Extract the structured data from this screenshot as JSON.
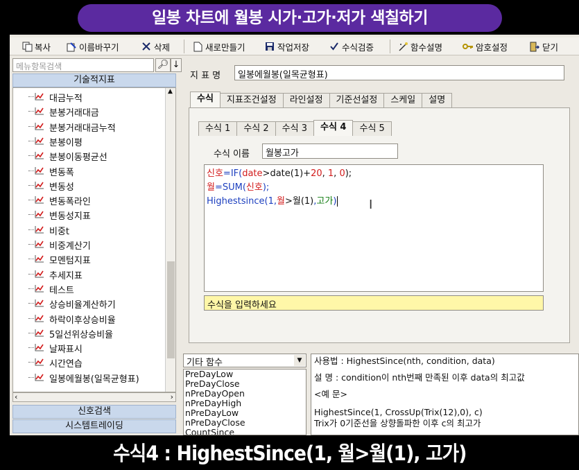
{
  "banner_title": "일봉 차트에 월봉 시가·고가·저가 색칠하기",
  "caption": "수식4 : HighestSince(1, 월>월(1), 고가)",
  "toolbar": {
    "copy": "복사",
    "rename": "이름바꾸기",
    "delete": "삭제",
    "new": "새로만들기",
    "save": "작업저장",
    "verify": "수식검증",
    "func_desc": "함수설명",
    "password": "암호설정",
    "close": "닫기"
  },
  "left": {
    "search_placeholder": "메뉴항목검색",
    "section_title": "기술적지표",
    "items": [
      "대금누적",
      "분봉거래대금",
      "분봉거래대금누적",
      "분봉이평",
      "분봉이동평균선",
      "변동폭",
      "변동성",
      "변동폭라인",
      "변동성지표",
      "비중t",
      "비중계산기",
      "모멘텀지표",
      "추세지표",
      "테스트",
      "상승비율계산하기",
      "하락이후상승비율",
      "5일선위상승비율",
      "날짜표시",
      "시간연습",
      "일봉에월봉(일목균형표)"
    ],
    "footer_tabs": [
      "신호검색",
      "시스템트레이딩"
    ]
  },
  "right": {
    "indicator_label": "지 표 명",
    "indicator_name": "일봉에월봉(일목균형표)",
    "tabs": [
      "수식",
      "지표조건설정",
      "라인설정",
      "기준선설정",
      "스케일",
      "설명"
    ],
    "formula_tabs": [
      "수식 1",
      "수식 2",
      "수식 3",
      "수식 4",
      "수식 5"
    ],
    "formula_name_label": "수식 이름",
    "formula_name": "월봉고가",
    "code": {
      "l1_var": "신호",
      "l1_eq": "=",
      "l1_fn": "IF(",
      "l1_a": "date",
      "l1_gt": ">",
      "l1_b": "date(1)+",
      "l1_n1": "20",
      "l1_c": ", ",
      "l1_n2": "1",
      "l1_d": ", ",
      "l1_n3": "0",
      "l1_e": ");",
      "l2_var": "월",
      "l2_eq": "=SUM(",
      "l2_arg": "신호",
      "l2_end": ");",
      "l3_fn": "Highestsince(1,",
      "l3_a": "월",
      "l3_gt": ">",
      "l3_b": "월(1)",
      "l3_c": ",",
      "l3_d": "고가",
      "l3_end": ")"
    },
    "hint": "수식을 입력하세요"
  },
  "func_category": "기타 함수",
  "func_list": [
    "PreDayLow",
    "PreDayClose",
    "nPreDayOpen",
    "nPreDayHigh",
    "nPreDayLow",
    "nPreDayClose",
    "CountSince"
  ],
  "help": {
    "usage": "사용법 : HighestSince(nth, condition, data)",
    "desc": "설   명 : condition이 nth번째 만족된 이후 data의 최고값",
    "example_label": "<예 문>",
    "example_code": "HighestSince(1, CrossUp(Trix(12),0), c)",
    "example_desc": "Trix가 0기준선을 상향돌파한 이후 c의 최고가"
  }
}
